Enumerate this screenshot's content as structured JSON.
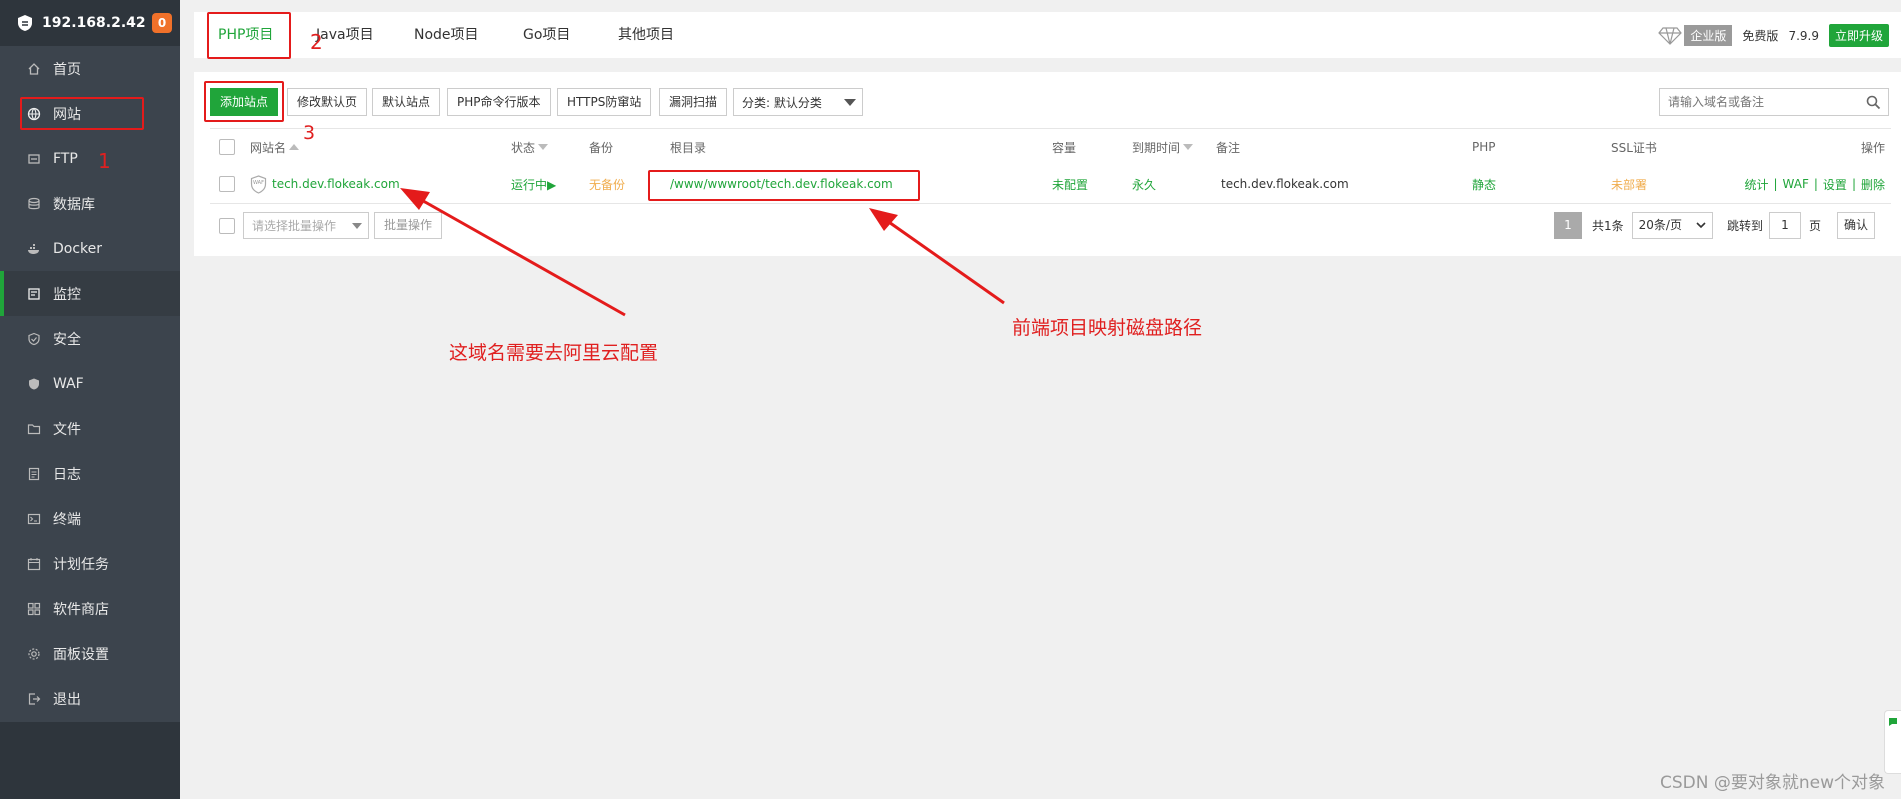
{
  "sidebar": {
    "host": "192.168.2.42",
    "badge": "0",
    "items": [
      {
        "label": "首页",
        "icon": "home-icon"
      },
      {
        "label": "网站",
        "icon": "globe-icon"
      },
      {
        "label": "FTP",
        "icon": "ftp-icon"
      },
      {
        "label": "数据库",
        "icon": "database-icon"
      },
      {
        "label": "Docker",
        "icon": "docker-icon"
      },
      {
        "label": "监控",
        "icon": "monitor-icon"
      },
      {
        "label": "安全",
        "icon": "shield-icon"
      },
      {
        "label": "WAF",
        "icon": "waf-icon"
      },
      {
        "label": "文件",
        "icon": "folder-icon"
      },
      {
        "label": "日志",
        "icon": "log-icon"
      },
      {
        "label": "终端",
        "icon": "terminal-icon"
      },
      {
        "label": "计划任务",
        "icon": "calendar-icon"
      },
      {
        "label": "软件商店",
        "icon": "grid-icon"
      },
      {
        "label": "面板设置",
        "icon": "gear-icon"
      },
      {
        "label": "退出",
        "icon": "exit-icon"
      }
    ]
  },
  "tabs": [
    "PHP项目",
    "Java项目",
    "Node项目",
    "Go项目",
    "其他项目"
  ],
  "topright": {
    "edition": "企业版",
    "free": "免费版",
    "version": "7.9.9",
    "upgrade": "立即升级"
  },
  "toolbar": {
    "add_site": "添加站点",
    "edit_default": "修改默认页",
    "default_site": "默认站点",
    "php_cli": "PHP命令行版本",
    "https_anti": "HTTPS防窜站",
    "vuln_scan": "漏洞扫描",
    "category": "分类: 默认分类",
    "search_placeholder": "请输入域名或备注"
  },
  "table": {
    "headers": {
      "name": "网站名",
      "status": "状态",
      "backup": "备份",
      "root": "根目录",
      "capacity": "容量",
      "expire": "到期时间",
      "note": "备注",
      "php": "PHP",
      "ssl": "SSL证书",
      "ops": "操作"
    },
    "row": {
      "waf": "WAF",
      "name": "tech.dev.flokeak.com",
      "status": "运行中▶",
      "backup": "无备份",
      "root": "/www/wwwroot/tech.dev.flokeak.com",
      "capacity": "未配置",
      "expire": "永久",
      "note": "tech.dev.flokeak.com",
      "php": "静态",
      "ssl": "未部署",
      "op_stats": "统计",
      "op_waf": "WAF",
      "op_settings": "设置",
      "op_delete": "删除",
      "sep": "|"
    }
  },
  "footer": {
    "batch_placeholder": "请选择批量操作",
    "batch_btn": "批量操作",
    "page": "1",
    "total": "共1条",
    "per_page": "20条/页",
    "jump_label": "跳转到",
    "jump_value": "1",
    "page_unit": "页",
    "confirm": "确认"
  },
  "annotations": {
    "n1": "1",
    "n2": "2",
    "n3": "3",
    "domain_note": "这域名需要去阿里云配置",
    "path_note": "前端项目映射磁盘路径"
  },
  "watermark": "CSDN @要对象就new个对象",
  "colors": {
    "green": "#20a53a",
    "red": "#e41b1b",
    "orange": "#f0ad4e",
    "sidebar": "#3c444d"
  }
}
